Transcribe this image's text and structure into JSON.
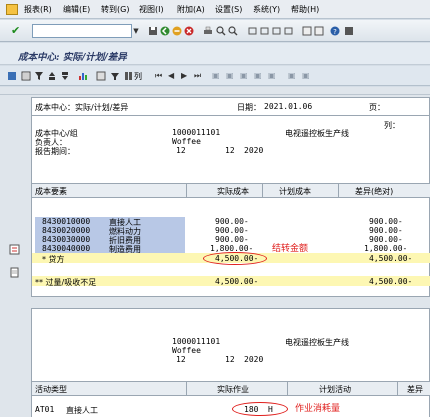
{
  "menu": {
    "items": [
      "报表(R)",
      "编辑(E)",
      "转到(G)",
      "视图(I)",
      "附加(A)",
      "设置(S)",
      "系统(Y)",
      "帮助(H)"
    ]
  },
  "toolbar": {
    "command_value": ""
  },
  "title": "成本中心: 实际/计划/差异",
  "app_toolbar": {
    "columns_label": "列"
  },
  "report1": {
    "header_title": "成本中心：实际/计划/差异",
    "date_label": "日期：",
    "date_value": "2021.01.06",
    "page_label": "页：",
    "col_label": "列：",
    "cc_label": "成本中心/组",
    "cc_value": "1000011101",
    "cc_desc": "电视遥控板生产线",
    "owner_label": "负责人：",
    "owner_value": "Woffee",
    "period_label": "报告期间：",
    "period_from": "12",
    "period_to": "12",
    "period_year": "2020"
  },
  "table1": {
    "headers": [
      "成本要素",
      "实际成本",
      "计划成本",
      "差异(绝对)"
    ],
    "rows": [
      {
        "code": "8430010000",
        "name": "直接人工",
        "actual": "900.00-",
        "variance": "900.00-"
      },
      {
        "code": "8430020000",
        "name": "燃料动力",
        "actual": "900.00-",
        "variance": "900.00-"
      },
      {
        "code": "8430030000",
        "name": "折旧费用",
        "actual": "900.00-",
        "variance": "900.00-"
      },
      {
        "code": "8430040000",
        "name": "制造费用",
        "actual": "1,800.00-",
        "variance": "1,800.00-"
      }
    ],
    "credit_row": {
      "label": "* 贷方",
      "actual": "4,500.00-",
      "variance": "4,500.00-"
    },
    "over_under_row": {
      "label": "** 过量/吸收不足",
      "actual": "4,500.00-",
      "variance": "4,500.00-"
    }
  },
  "annotation1": "结转金额",
  "report2": {
    "cc_value": "1000011101",
    "cc_desc": "电视遥控板生产线",
    "owner_value": "Woffee",
    "period_from": "12",
    "period_to": "12",
    "period_year": "2020"
  },
  "table2": {
    "headers": [
      "活动类型",
      "实际作业",
      "计划活动",
      "差异"
    ],
    "row": {
      "code": "AT01",
      "name": "直接人工",
      "actual_qty": "180",
      "unit": "H"
    }
  },
  "annotation2": "作业消耗量",
  "colors": {
    "annotation": "#e0201e",
    "row_highlight": "#fdf7b3",
    "cell_blue": "#b8c8e6"
  }
}
